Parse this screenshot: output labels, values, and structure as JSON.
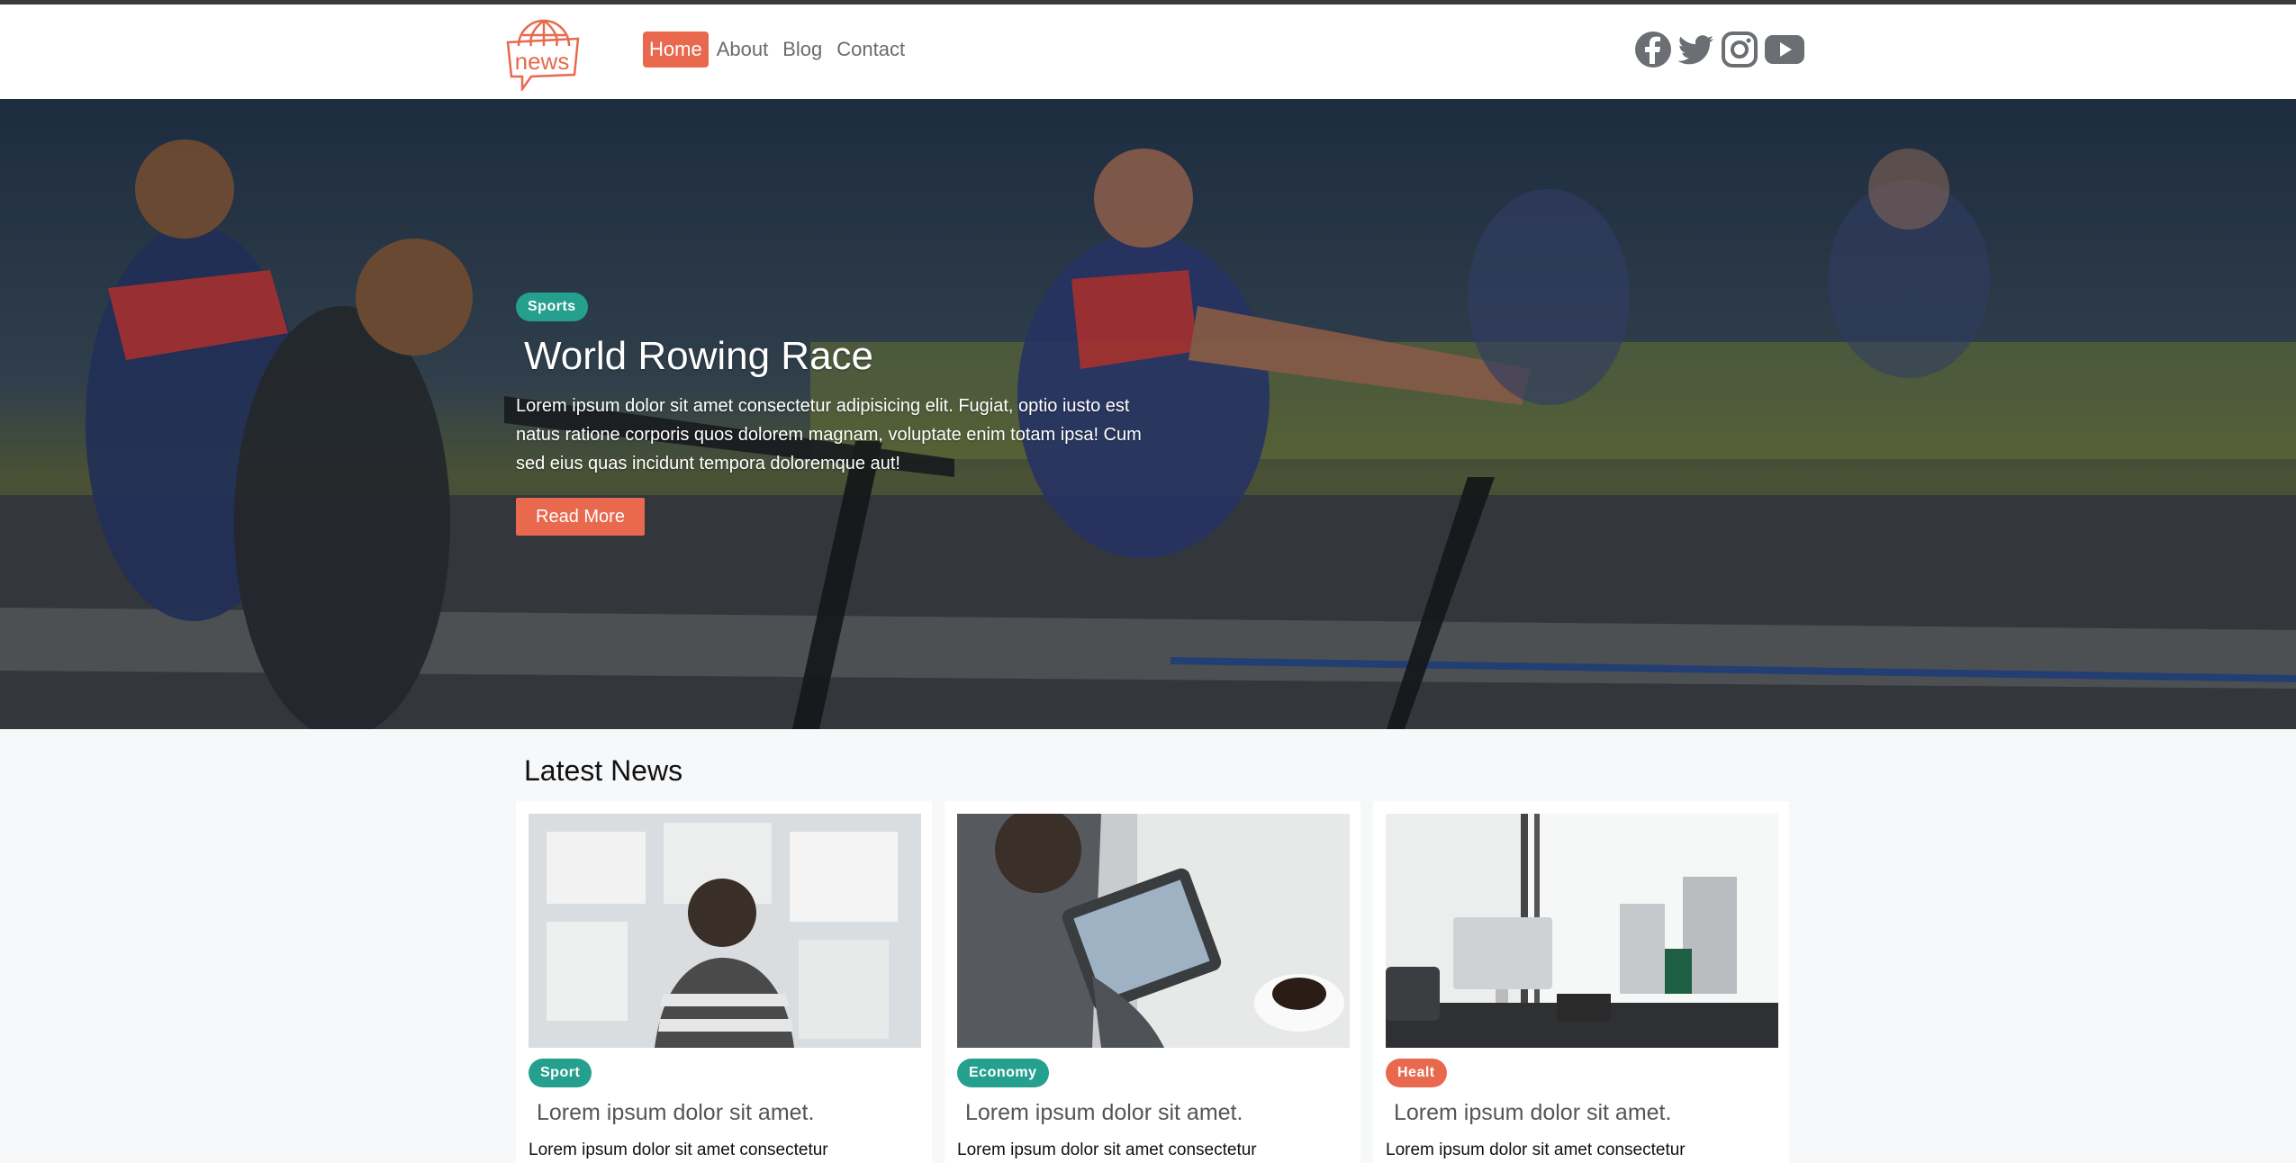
{
  "header": {
    "logo_text": "news",
    "nav": [
      {
        "label": "Home",
        "active": true
      },
      {
        "label": "About",
        "active": false
      },
      {
        "label": "Blog",
        "active": false
      },
      {
        "label": "Contact",
        "active": false
      }
    ],
    "social_icons": [
      "facebook-icon",
      "twitter-icon",
      "instagram-icon",
      "youtube-icon"
    ]
  },
  "hero": {
    "badge": "Sports",
    "title": "World Rowing Race",
    "text": "Lorem ipsum dolor sit amet consectetur adipisicing elit. Fugiat, optio iusto est natus ratione corporis quos dolorem magnam, voluptate enim totam ipsa! Cum sed eius quas incidunt tempora doloremque aut!",
    "button": "Read More"
  },
  "latest": {
    "title": "Latest News",
    "cards": [
      {
        "badge": "Sport",
        "badge_color": "#25a08e",
        "title": "Lorem ipsum dolor sit amet.",
        "text": "Lorem ipsum dolor sit amet consectetur"
      },
      {
        "badge": "Economy",
        "badge_color": "#25a08e",
        "title": "Lorem ipsum dolor sit amet.",
        "text": "Lorem ipsum dolor sit amet consectetur"
      },
      {
        "badge": "Healt",
        "badge_color": "#e8694e",
        "title": "Lorem ipsum dolor sit amet.",
        "text": "Lorem ipsum dolor sit amet consectetur"
      }
    ]
  },
  "colors": {
    "accent": "#e8694e",
    "teal": "#25a08e"
  }
}
